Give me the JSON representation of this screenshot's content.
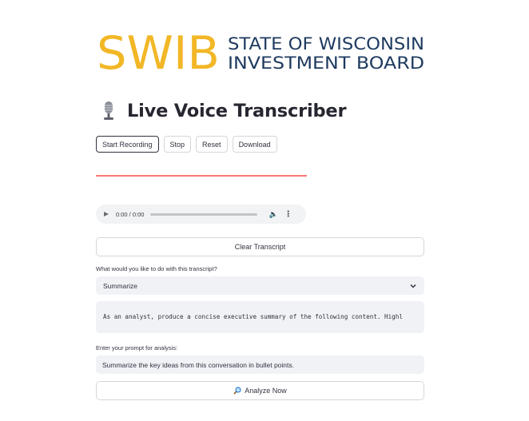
{
  "logo": {
    "mark": "SWIB",
    "line1": "STATE OF WISCONSIN",
    "line2": "INVESTMENT BOARD",
    "colors": {
      "gold": "#f2b726",
      "navy": "#1d3a5f"
    }
  },
  "header": {
    "icon": "microphone-icon",
    "title": "Live Voice Transcriber"
  },
  "controls": {
    "start_label": "Start Recording",
    "stop_label": "Stop",
    "reset_label": "Reset",
    "download_label": "Download"
  },
  "audio": {
    "time": "0:00 / 0:00",
    "progress": 0
  },
  "clear_label": "Clear Transcript",
  "action": {
    "label": "What would you like to do with this transcript?",
    "selected": "Summarize"
  },
  "prompt_template": "As an analyst, produce a concise executive summary of the following content. Highl",
  "prompt": {
    "label": "Enter your prompt for analysis:",
    "value": "Summarize the key ideas from this conversation in bullet points."
  },
  "analyze_label": "Analyze Now",
  "colors": {
    "accent": "#ff4b4b",
    "input_bg": "#f0f2f6"
  }
}
